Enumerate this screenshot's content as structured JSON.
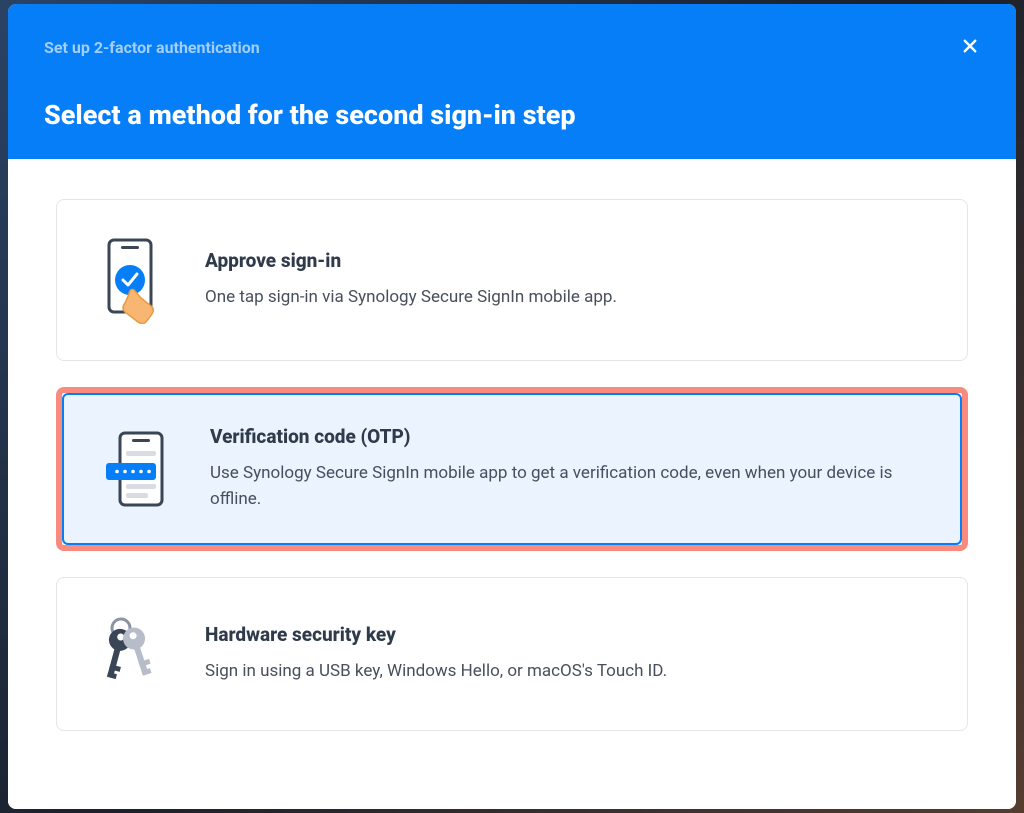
{
  "header": {
    "label": "Set up 2-factor authentication",
    "title": "Select a method for the second sign-in step"
  },
  "options": {
    "approve": {
      "title": "Approve sign-in",
      "description": "One tap sign-in via Synology Secure SignIn mobile app."
    },
    "otp": {
      "title": "Verification code (OTP)",
      "description": "Use Synology Secure SignIn mobile app to get a verification code, even when your device is offline."
    },
    "hardware": {
      "title": "Hardware security key",
      "description": "Sign in using a USB key, Windows Hello, or macOS's Touch ID."
    }
  }
}
